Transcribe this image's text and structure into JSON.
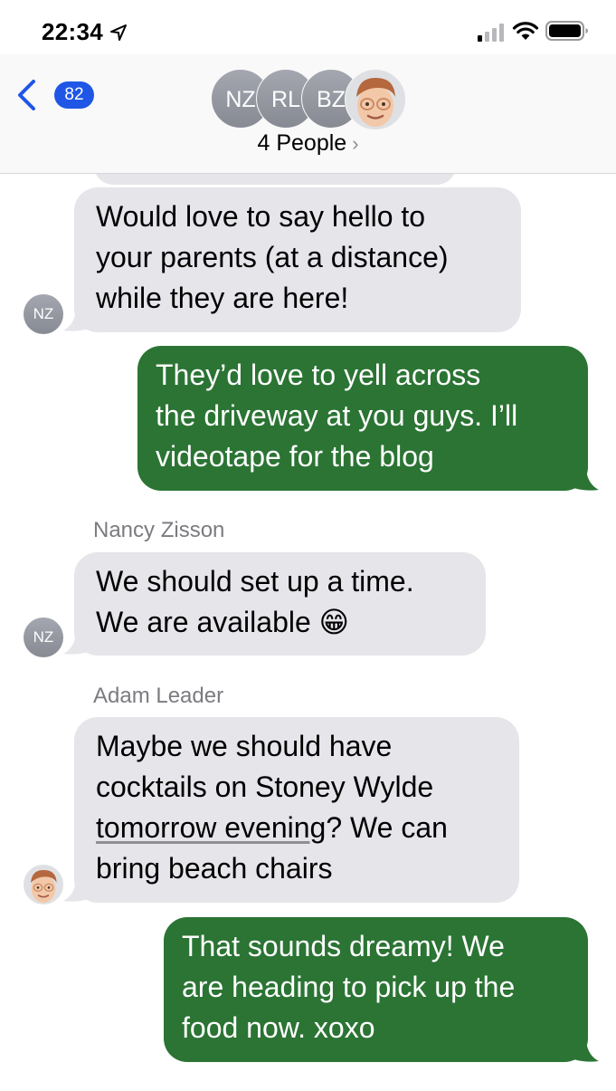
{
  "status_bar": {
    "time": "22:34"
  },
  "header": {
    "back_badge": "82",
    "avatars": [
      "NZ",
      "RL",
      "BZ"
    ],
    "group_title": "4 People",
    "chevron": "›"
  },
  "messages": [
    {
      "direction": "incoming",
      "sender_initials": "NZ",
      "lines": [
        "Would love to say hello to",
        "your parents (at a distance)",
        "while they are here!"
      ]
    },
    {
      "direction": "outgoing",
      "lines": [
        "They’d love to yell across",
        "the driveway at you guys. I’ll",
        "videotape for the blog"
      ]
    },
    {
      "direction": "incoming",
      "sender_name": "Nancy Zisson",
      "sender_initials": "NZ",
      "lines": [
        "We should set up a time.",
        "We are available 😁"
      ]
    },
    {
      "direction": "incoming",
      "sender_name": "Adam Leader",
      "lines": [
        "Maybe we should have",
        "cocktails on Stoney Wylde",
        "tomorrow evening",
        "? We can",
        "bring beach chairs"
      ]
    },
    {
      "direction": "outgoing",
      "lines": [
        "That sounds dreamy! We",
        "are heading to pick up the",
        "food now. xoxo"
      ]
    }
  ],
  "colors": {
    "outgoing_bubble": "#2b7434",
    "incoming_bubble": "#e5e5ea",
    "badge": "#1f56e6"
  },
  "icons": [
    "location-arrow-icon",
    "cellular-signal-icon",
    "wifi-icon",
    "battery-icon",
    "back-chevron-icon",
    "memoji-avatar-icon"
  ]
}
